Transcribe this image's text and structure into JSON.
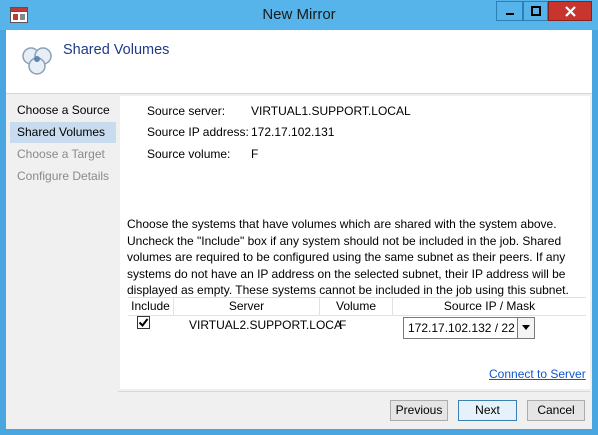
{
  "window": {
    "title": "New Mirror"
  },
  "header": {
    "title": "Shared Volumes"
  },
  "nav": {
    "items": [
      {
        "label": "Choose a Source",
        "state": "normal"
      },
      {
        "label": "Shared Volumes",
        "state": "active"
      },
      {
        "label": "Choose a Target",
        "state": "disabled"
      },
      {
        "label": "Configure Details",
        "state": "disabled"
      }
    ]
  },
  "source": {
    "server_label": "Source server:",
    "server_value": "VIRTUAL1.SUPPORT.LOCAL",
    "ip_label": "Source IP address:",
    "ip_value": "172.17.102.131",
    "volume_label": "Source volume:",
    "volume_value": "F"
  },
  "description": "Choose the systems that have volumes which are shared with the system above. Uncheck the \"Include\" box if any system should not be included in the job. Shared volumes are required to be configured using the same subnet as their peers. If any systems do not have an IP address on the selected subnet, their IP address will be displayed as empty. These systems cannot be included in the job using this subnet.",
  "grid": {
    "columns": [
      "Include",
      "Server",
      "Volume",
      "Source IP / Mask"
    ],
    "rows": [
      {
        "include": true,
        "server": "VIRTUAL2.SUPPORT.LOCA",
        "volume": "F",
        "ip_mask": "172.17.102.132 / 22"
      }
    ]
  },
  "link": {
    "connect_label": "Connect to Server"
  },
  "footer": {
    "previous_label": "Previous",
    "next_label": "Next",
    "cancel_label": "Cancel"
  },
  "colors": {
    "titlebar": "#56b4ea",
    "close": "#c7352d",
    "accent_text": "#1e3b8a",
    "nav_active": "#c9dcef",
    "link": "#1155cc"
  }
}
